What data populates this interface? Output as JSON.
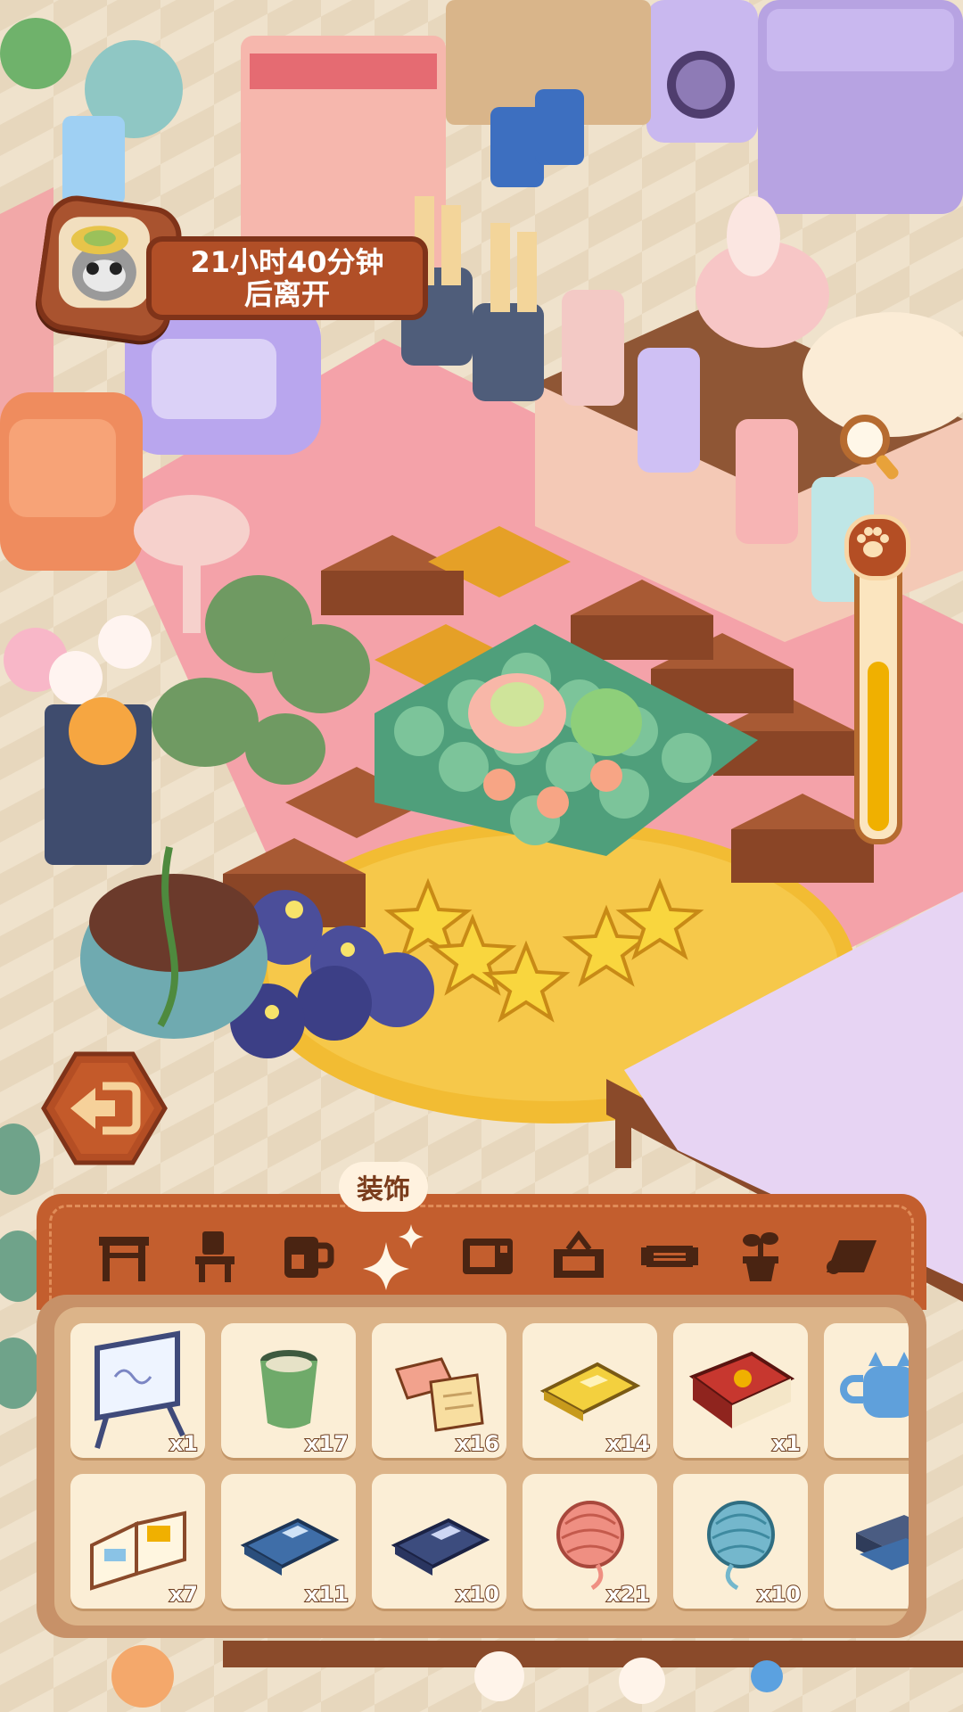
{
  "timer": {
    "line1": "21小时40分钟",
    "line2": "后离开"
  },
  "tab_label": "装饰",
  "tabs": [
    {
      "icon": "table-icon"
    },
    {
      "icon": "chair-icon"
    },
    {
      "icon": "mug-icon"
    },
    {
      "icon": "sparkle-decor-icon"
    },
    {
      "icon": "microwave-icon"
    },
    {
      "icon": "basket-icon"
    },
    {
      "icon": "rug-icon"
    },
    {
      "icon": "potted-plant-icon"
    },
    {
      "icon": "wallpaper-icon"
    }
  ],
  "active_tab": 3,
  "items": [
    {
      "icon": "whiteboard-icon",
      "count": "x1"
    },
    {
      "icon": "tea-cup-icon",
      "count": "x17"
    },
    {
      "icon": "notes-icon",
      "count": "x16"
    },
    {
      "icon": "yellow-book-icon",
      "count": "x14"
    },
    {
      "icon": "red-book-icon",
      "count": "x1"
    },
    {
      "icon": "blue-cat-cup-icon",
      "count": ""
    },
    {
      "icon": "open-book-icon",
      "count": "x7"
    },
    {
      "icon": "blue-book-icon",
      "count": "x11"
    },
    {
      "icon": "navy-book-icon",
      "count": "x10"
    },
    {
      "icon": "pink-yarn-icon",
      "count": "x21"
    },
    {
      "icon": "blue-yarn-icon",
      "count": "x10"
    },
    {
      "icon": "book-stack-icon",
      "count": ""
    }
  ],
  "colors": {
    "panel_orange": "#c35e2e",
    "panel_tan": "#c79168",
    "slot_bg": "#fbeed6",
    "accent_yellow": "#f0b000"
  }
}
